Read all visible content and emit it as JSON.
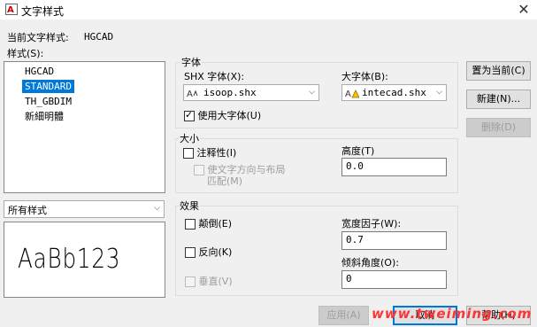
{
  "window": {
    "title": "文字样式",
    "close_label": "✕"
  },
  "current_style_label": "当前文字样式:",
  "current_style_value": "HGCAD",
  "styles_label": "样式(S):",
  "styles": [
    "HGCAD",
    "STANDARD",
    "TH_GBDIM",
    "新細明體"
  ],
  "selected_style": "STANDARD",
  "filter": {
    "value": "所有样式"
  },
  "preview_text": "AaBb123",
  "font_group": {
    "title": "字体",
    "shx_label": "SHX 字体(X):",
    "shx_value": "isoop.shx",
    "big_font_label": "大字体(B):",
    "big_font_value": "intecad.shx",
    "use_big_font_label": "使用大字体(U)",
    "use_big_font_checked": true
  },
  "size_group": {
    "title": "大小",
    "annotative_label": "注释性(I)",
    "match_orientation_line1": "使文字方向与布局",
    "match_orientation_line2": "匹配(M)",
    "height_label": "高度(T)",
    "height_value": "0.0"
  },
  "effects_group": {
    "title": "效果",
    "upside_down_label": "颠倒(E)",
    "backwards_label": "反向(K)",
    "vertical_label": "垂直(V)",
    "width_factor_label": "宽度因子(W):",
    "width_factor_value": "0.7",
    "oblique_label": "倾斜角度(O):",
    "oblique_value": "0"
  },
  "buttons": {
    "set_current": "置为当前(C)",
    "new": "新建(N)...",
    "delete": "删除(D)",
    "apply": "应用(A)",
    "cancel": "取消",
    "help": "帮助(H)"
  },
  "watermark": "www.tweiming.com"
}
